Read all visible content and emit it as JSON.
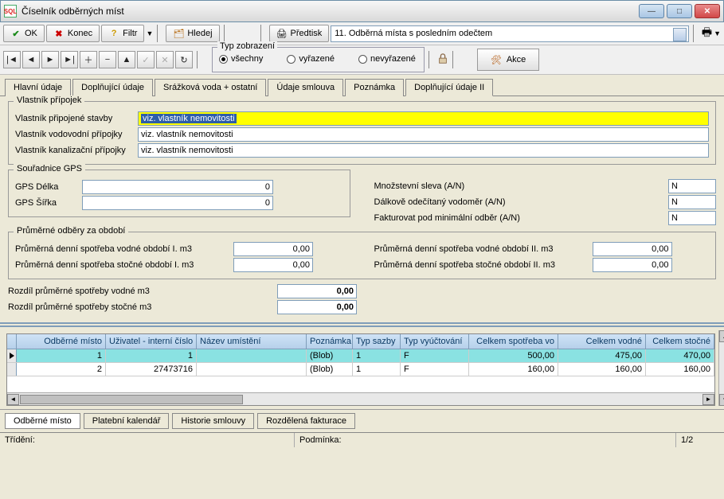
{
  "window": {
    "title": "Číselník odběrných míst",
    "icon_label": "SQL"
  },
  "toolbar1": {
    "ok": "OK",
    "konec": "Konec",
    "filtr": "Filtr",
    "hledej": "Hledej",
    "predtisk": "Předtisk",
    "report_dropdown": "11. Odběrná místa s posledním odečtem"
  },
  "typ_zobrazeni": {
    "legend": "Typ zobrazení",
    "opt_all": "všechny",
    "opt_vyrazene": "vyřazené",
    "opt_nevyrazene": "nevyřazené",
    "selected": "opt_all"
  },
  "akce": "Akce",
  "tabs": {
    "hlavni": "Hlavní údaje",
    "doplnujici": "Doplňující údaje",
    "srazkova": "Srážková voda + ostatní",
    "smlouva": "Údaje smlouva",
    "poznamka": "Poznámka",
    "doplnujici2": "Doplňující údaje II"
  },
  "vlastnik": {
    "legend": "Vlastník přípojek",
    "stavba_lbl": "Vlastník připojené stavby",
    "stavba_val": "viz. vlastník nemovitosti",
    "vod_lbl": "Vlastník vodovodní přípojky",
    "vod_val": "viz. vlastník nemovitosti",
    "kan_lbl": "Vlastník kanalizační přípojky",
    "kan_val": "viz. vlastník nemovitosti"
  },
  "gps": {
    "legend": "Souřadnice GPS",
    "delka_lbl": "GPS Délka",
    "delka_val": "0",
    "sirka_lbl": "GPS Šířka",
    "sirka_val": "0"
  },
  "flags": {
    "sleva_lbl": "Množstevní sleva (A/N)",
    "sleva_val": "N",
    "dalk_lbl": "Dálkově odečítaný vodoměr (A/N)",
    "dalk_val": "N",
    "fakturovat_lbl": "Fakturovat pod minimální odběr (A/N)",
    "fakturovat_val": "N"
  },
  "prumerne": {
    "legend": "Průměrné odběry za období",
    "vod1_lbl": "Průměrná denní spotřeba vodné období I. m3",
    "vod1_val": "0,00",
    "stoc1_lbl": "Průměrná denní spotřeba stočné období I. m3",
    "stoc1_val": "0,00",
    "vod2_lbl": "Průměrná denní spotřeba vodné období II. m3",
    "vod2_val": "0,00",
    "stoc2_lbl": "Průměrná denní spotřeba stočné období II. m3",
    "stoc2_val": "0,00"
  },
  "rozdil": {
    "vod_lbl": "Rozdíl průměrné spotřeby vodné m3",
    "vod_val": "0,00",
    "stoc_lbl": "Rozdíl průměrné spotřeby stočné m3",
    "stoc_val": "0,00"
  },
  "grid": {
    "headers": {
      "om": "Odběrné místo",
      "uzi": "Uživatel - interní číslo",
      "naz": "Název umístění",
      "poz": "Poznámka",
      "ts": "Typ sazby",
      "tv": "Typ vyúčtování",
      "csv": "Celkem spotřeba vo",
      "cv": "Celkem vodné",
      "cs": "Celkem stočné"
    },
    "rows": [
      {
        "om": "1",
        "uzi": "1",
        "naz": "",
        "poz": "(Blob)",
        "ts": "1",
        "tv": "F",
        "csv": "500,00",
        "cv": "475,00",
        "cs": "470,00"
      },
      {
        "om": "2",
        "uzi": "27473716",
        "naz": "",
        "poz": "(Blob)",
        "ts": "1",
        "tv": "F",
        "csv": "160,00",
        "cv": "160,00",
        "cs": "160,00"
      }
    ]
  },
  "bottom_tabs": {
    "odberne": "Odběrné místo",
    "platebni": "Platební kalendář",
    "historie": "Historie smlouvy",
    "rozdelena": "Rozdělená fakturace"
  },
  "statusbar": {
    "trideni": "Třídění:",
    "podminka": "Podmínka:",
    "pos": "1/2"
  }
}
